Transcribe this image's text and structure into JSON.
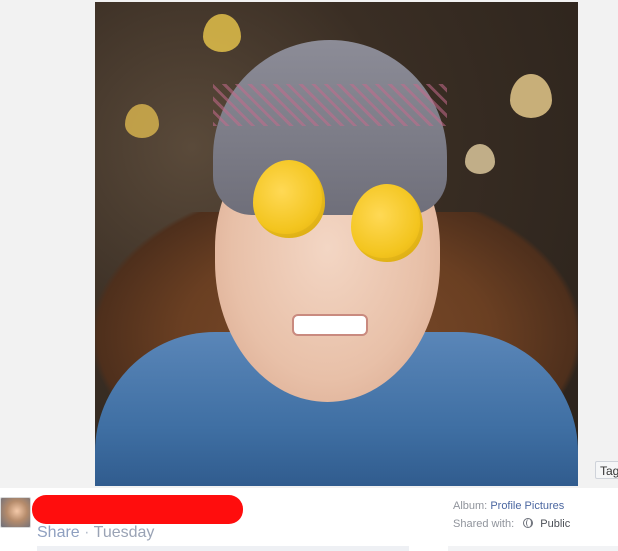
{
  "photo": {
    "alt": "",
    "subject_icon": "photo-icon"
  },
  "tag_button": {
    "label": "Tag"
  },
  "post": {
    "share_label": "Share",
    "separator": "·",
    "time_label": "Tuesday",
    "album_prefix": "Album:",
    "album_name": "Profile Pictures",
    "shared_prefix": "Shared with:",
    "audience": "Public",
    "audience_icon": "globe-icon"
  },
  "colors": {
    "redaction": "#ff0d0d",
    "link": "#4b67a1",
    "muted": "#90949c"
  }
}
